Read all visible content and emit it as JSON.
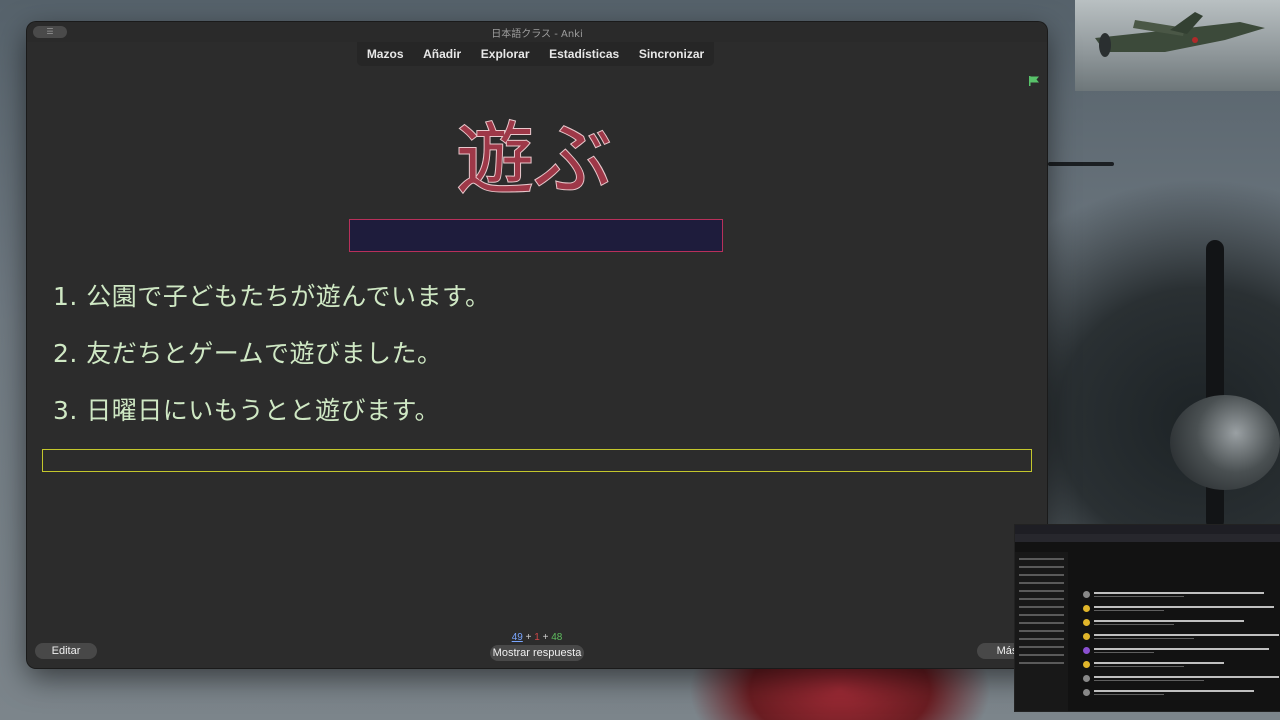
{
  "window": {
    "title": "日本語クラス - Anki",
    "menu_button": "☰"
  },
  "toolbar": {
    "decks": "Mazos",
    "add": "Añadir",
    "browse": "Explorar",
    "stats": "Estadísticas",
    "sync": "Sincronizar"
  },
  "card": {
    "word": "遊ぶ",
    "sentences": [
      "1. 公園で子どもたちが遊んでいます。",
      "2. 友だちとゲームで遊びました。",
      "3. 日曜日にいもうとと遊びます。"
    ],
    "typed_answer": ""
  },
  "bottom": {
    "edit": "Editar",
    "show_answer": "Mostrar respuesta",
    "more": "Más",
    "count_new": "49",
    "count_learn": "1",
    "count_review": "48",
    "plus": "+"
  },
  "colors": {
    "kanji_fill": "#9e3848",
    "sentence_text": "#cfe8c4",
    "answer_box_border": "#b8305a",
    "input_border": "#c4c72c",
    "flag": "#58c26a"
  },
  "icons": {
    "flag": "flag-icon",
    "window_menu": "menu-icon"
  }
}
